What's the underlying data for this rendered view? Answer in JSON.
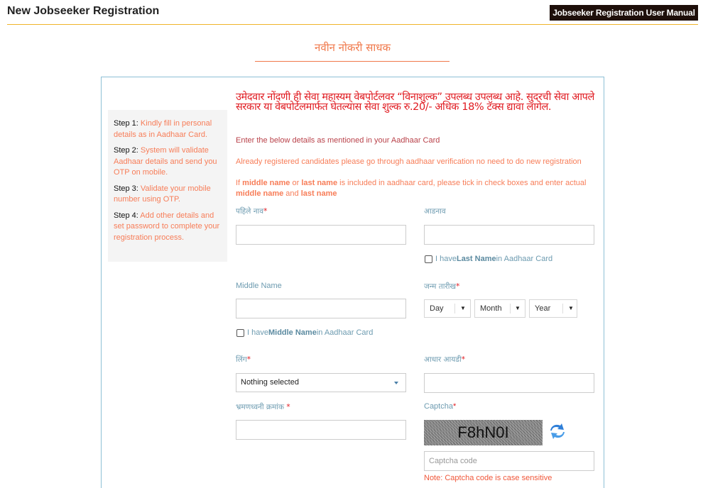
{
  "header": {
    "title": "New Jobseeker Registration",
    "manual_button": "Jobseeker Registration User Manual"
  },
  "section_title": "नवीन नोकरी साधक",
  "steps": [
    {
      "label": "Step 1:",
      "text": " Kindly fill in personal details as in Aadhaar Card."
    },
    {
      "label": "Step 2:",
      "text": " System will validate Aadhaar details and send you OTP on mobile."
    },
    {
      "label": "Step 3:",
      "text": " Validate your mobile number using OTP."
    },
    {
      "label": "Step 4:",
      "text": " Add other details and set password to complete your registration process."
    }
  ],
  "notice": "उमेदवार नोंदणी ही सेवा महास्यम् वेबपोर्टलवर “विनाशुल्क” उपलब्ध उपलब्ध आहे. सुदरची सेवा आपले सरकार या वेबपोर्टलमार्फत घेतल्यास सेवा शुल्क रु.20/- अधिक 18% टॅक्स द्यावा लागेल.",
  "info": {
    "line1": "Enter the below details as mentioned in your Aadhaar Card",
    "line2": "Already registered candidates please go through aadhaar verification no need to do new registration",
    "line3_parts": [
      "If ",
      "middle name",
      " or ",
      "last name",
      " is included in aadhaar card, please tick in check boxes and enter actual ",
      "middle name",
      " and ",
      "last name"
    ]
  },
  "form": {
    "first_name": {
      "label": "पहिले नाव",
      "required": "*",
      "value": ""
    },
    "surname": {
      "label": "आडनाव",
      "value": ""
    },
    "last_name_check": {
      "prefix": "I have",
      "bold": "Last Name",
      "suffix": " in Aadhaar Card",
      "checked": false
    },
    "middle_name": {
      "label": "Middle Name",
      "value": ""
    },
    "middle_name_check": {
      "prefix": "I have ",
      "bold": "Middle Name",
      "suffix": " in Aadhaar Card",
      "checked": false
    },
    "dob": {
      "label": "जन्म तारीख",
      "required": "*",
      "day": "Day",
      "month": "Month",
      "year": "Year"
    },
    "gender": {
      "label": "लिंग",
      "required": "*",
      "selected": "Nothing selected"
    },
    "aadhaar_id": {
      "label": "आधार आयडी",
      "required": "*",
      "value": ""
    },
    "mobile": {
      "label": "भ्रमणध्वनी क्रमांक ",
      "required": "*",
      "value": ""
    },
    "captcha": {
      "label": "Captcha",
      "required": "*",
      "image_text": "F8hN0I",
      "placeholder": "Captcha code",
      "note": "Note: Captcha code is case sensitive"
    }
  },
  "icons": {
    "refresh": "refresh-icon",
    "dropdown": "caret-down-icon"
  },
  "colors": {
    "accent_orange": "#f77d58",
    "header_rule": "#f0b429",
    "notice_red": "#e0191f",
    "manual_button_bg": "#1e0f0a",
    "panel_border": "#8ec0d6"
  }
}
